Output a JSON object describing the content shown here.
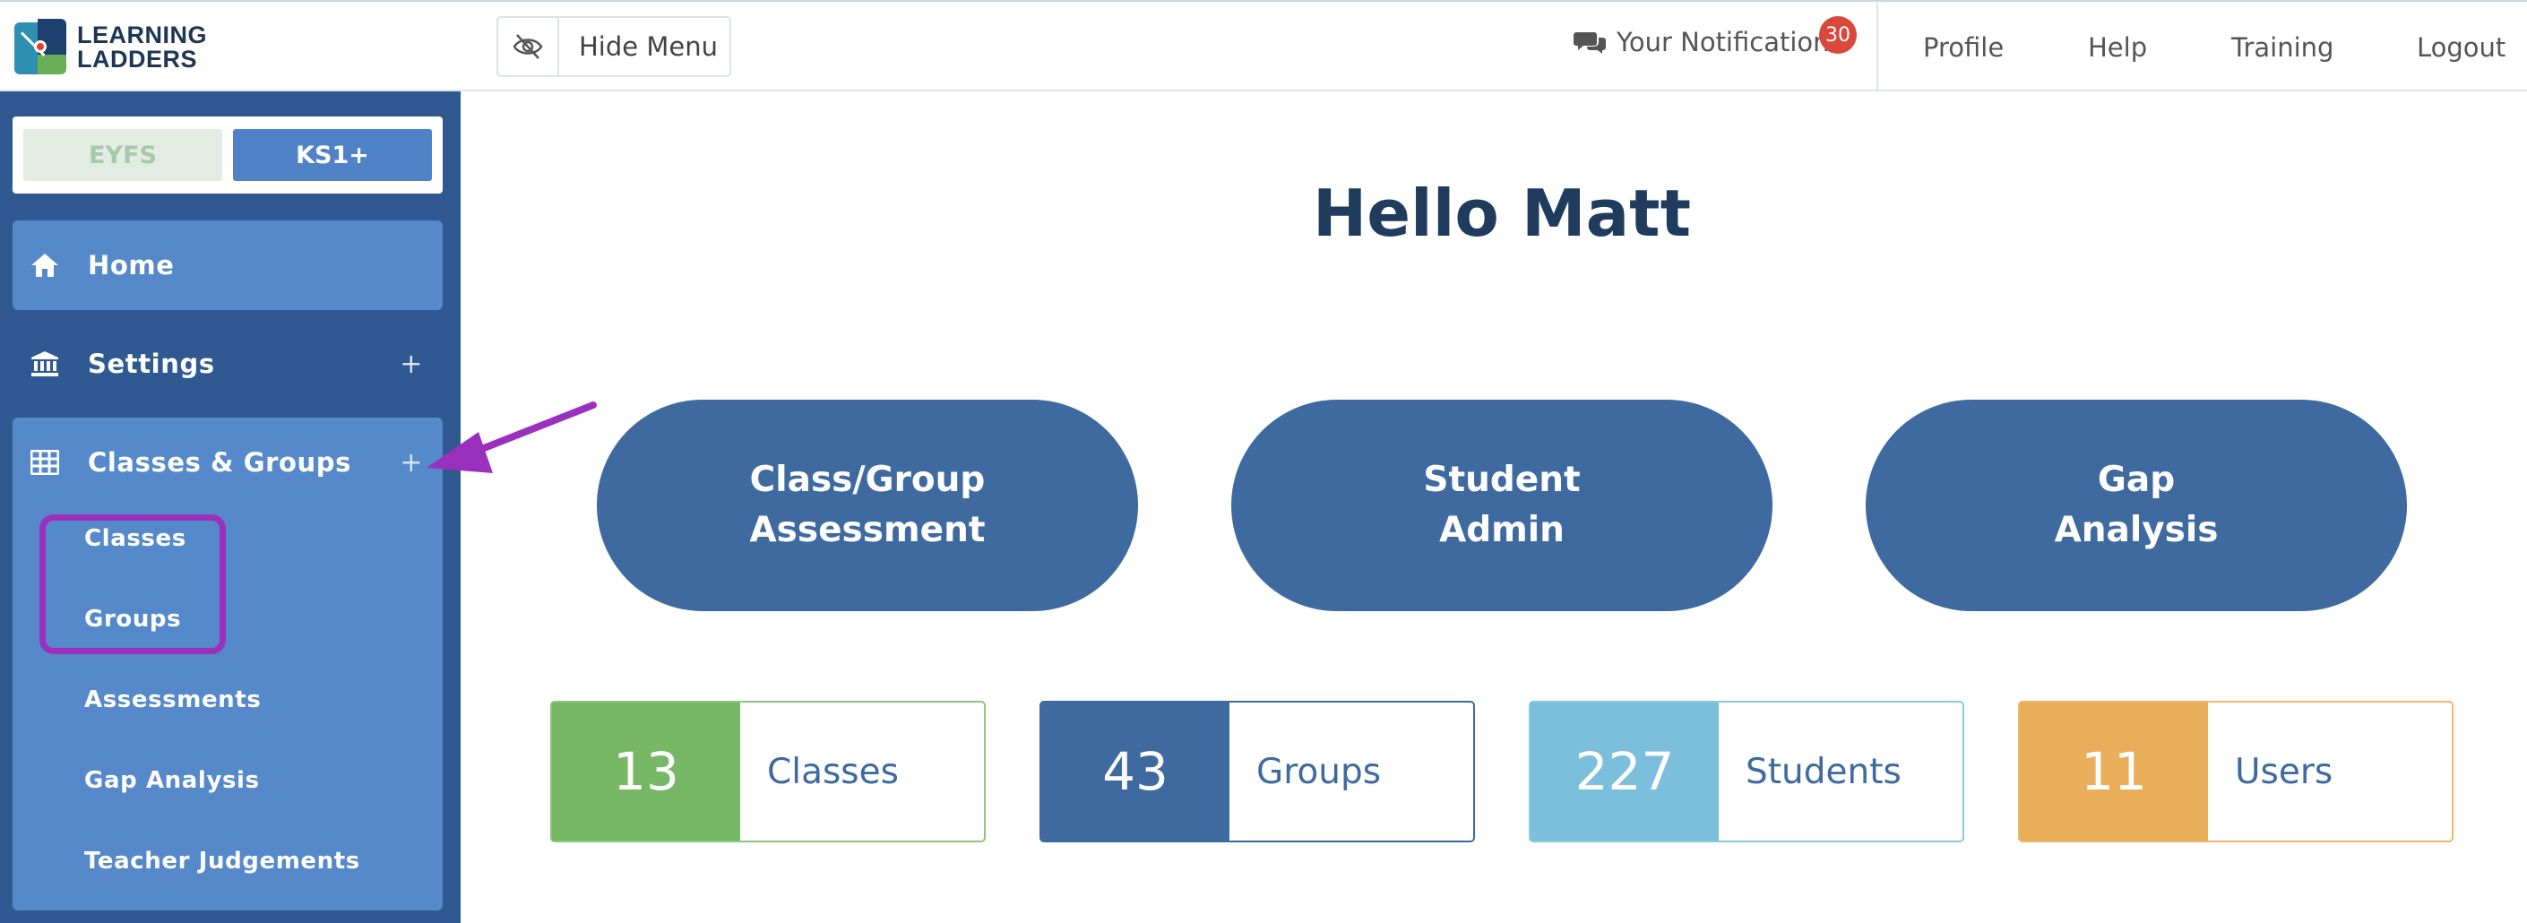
{
  "logo": {
    "line1": "LEARNING",
    "line2": "LADDERS"
  },
  "header": {
    "hide_menu": "Hide Menu",
    "notifications": "Your Notifications",
    "notifications_count": "30",
    "nav": [
      "Profile",
      "Help",
      "Training",
      "Logout"
    ]
  },
  "sidebar": {
    "stages": [
      "EYFS",
      "KS1+"
    ],
    "home": "Home",
    "settings": "Settings",
    "classes_groups": "Classes & Groups",
    "plus": "+",
    "sub_items": [
      "Classes",
      "Groups",
      "Assessments",
      "Gap Analysis",
      "Teacher Judgements"
    ]
  },
  "main": {
    "greeting": "Hello Matt",
    "pills": [
      {
        "line1": "Class/Group",
        "line2": "Assessment"
      },
      {
        "line1": "Student",
        "line2": "Admin"
      },
      {
        "line1": "Gap",
        "line2": "Analysis"
      }
    ],
    "stats": [
      {
        "value": "13",
        "label": "Classes",
        "color": "#76b865"
      },
      {
        "value": "43",
        "label": "Groups",
        "color": "#3e6aa0"
      },
      {
        "value": "227",
        "label": "Students",
        "color": "#7bbfdc"
      },
      {
        "value": "11",
        "label": "Users",
        "color": "#e8ae5a"
      }
    ]
  },
  "colors": {
    "sidebar_bg": "#2f5990",
    "sidebar_active": "#5589c9",
    "pill_bg": "#3e6aa0",
    "highlight": "#9b30bf",
    "badge": "#d9483b"
  }
}
